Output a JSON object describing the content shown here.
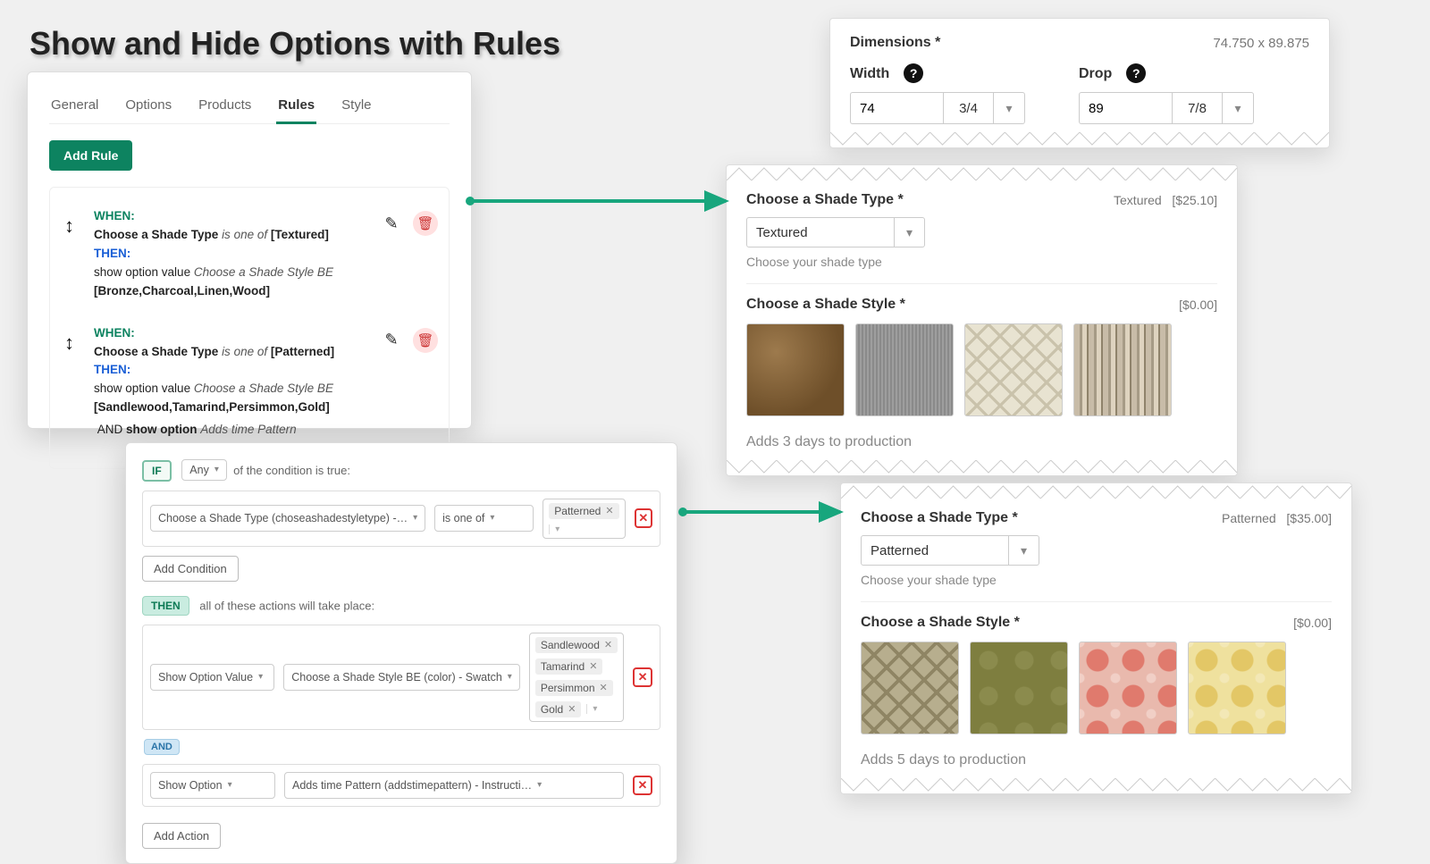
{
  "title": "Show and Hide Options with Rules",
  "admin": {
    "tabs": [
      "General",
      "Options",
      "Products",
      "Rules",
      "Style"
    ],
    "active_tab": "Rules",
    "add_rule_label": "Add Rule",
    "kw_when": "WHEN:",
    "kw_then": "THEN:",
    "kw_and": "AND",
    "rule1": {
      "cond_prefix": "Choose a Shade Type",
      "cond_verb": "is one of",
      "cond_vals": "[Textured]",
      "act_prefix": "show option value",
      "act_target": "Choose a Shade Style BE",
      "act_vals": "[Bronze,Charcoal,Linen,Wood]"
    },
    "rule2": {
      "cond_prefix": "Choose a Shade Type",
      "cond_verb": "is one of",
      "cond_vals": "[Patterned]",
      "act_prefix": "show option value",
      "act_target": "Choose a Shade Style BE",
      "act_vals": "[Sandlewood,Tamarind,Persimmon,Gold]",
      "act2_prefix": "show option",
      "act2_target": "Adds time Pattern"
    }
  },
  "editor": {
    "if_label": "IF",
    "any_label": "Any",
    "cond_suffix": "of the condition is true:",
    "cond_field": "Choose a Shade Type (choseashadestyletype) -…",
    "cond_op": "is one of",
    "cond_tag1": "Patterned",
    "add_condition": "Add Condition",
    "then_label": "THEN",
    "then_suffix": "all of these actions will take place:",
    "act_type": "Show Option Value",
    "act_field": "Choose a Shade Style BE (color) - Swatch",
    "act_tags": [
      "Sandlewood",
      "Tamarind",
      "Persimmon",
      "Gold"
    ],
    "and_label": "AND",
    "act2_type": "Show Option",
    "act2_field": "Adds time Pattern (addstimepattern) - Instructi…",
    "add_action": "Add Action"
  },
  "dim": {
    "header": "Dimensions *",
    "sizestr": "74.750 x 89.875",
    "width_label": "Width",
    "drop_label": "Drop",
    "width_val": "74",
    "width_frac": "3/4",
    "drop_val": "89",
    "drop_frac": "7/8"
  },
  "opt1": {
    "type_label": "Choose a Shade Type *",
    "type_value": "Textured",
    "type_price": "[$25.10]",
    "type_hint": "Choose your shade type",
    "style_label": "Choose a Shade Style *",
    "style_price": "[$0.00]",
    "note": "Adds 3 days to production"
  },
  "opt2": {
    "type_label": "Choose a Shade Type *",
    "type_value": "Patterned",
    "type_price": "[$35.00]",
    "type_hint": "Choose your shade type",
    "style_label": "Choose a Shade Style *",
    "style_price": "[$0.00]",
    "note": "Adds 5 days to production"
  }
}
